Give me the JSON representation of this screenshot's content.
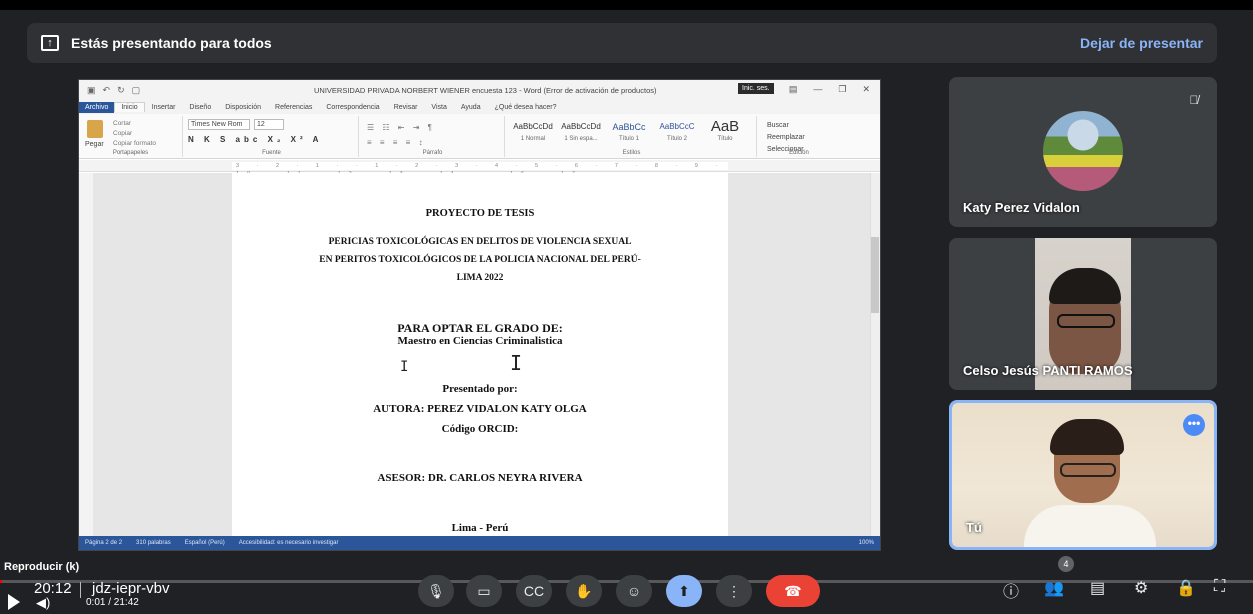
{
  "banner": {
    "message": "Estás presentando para todos",
    "stop_label": "Dejar de presentar"
  },
  "word": {
    "title": "UNIVERSIDAD PRIVADA NORBERT WIENER encuesta 123  -  Word (Error de activación de productos)",
    "signin": "Inic. ses.",
    "tabs": [
      "Archivo",
      "Inicio",
      "Insertar",
      "Diseño",
      "Disposición",
      "Referencias",
      "Correspondencia",
      "Revisar",
      "Vista",
      "Ayuda",
      "¿Qué desea hacer?"
    ],
    "clipboard": {
      "paste": "Pegar",
      "cut": "Cortar",
      "copy": "Copiar",
      "format": "Copiar formato",
      "label": "Portapapeles"
    },
    "font": {
      "name": "Times New Rom",
      "size": "12",
      "label": "Fuente"
    },
    "paragraph_label": "Párrafo",
    "styles": [
      {
        "sample": "AaBbCcDd",
        "name": "1 Normal"
      },
      {
        "sample": "AaBbCcDd",
        "name": "1 Sin espa..."
      },
      {
        "sample": "AaBbCc",
        "name": "Título 1"
      },
      {
        "sample": "AaBbCcC",
        "name": "Título 2"
      },
      {
        "sample": "AaB",
        "name": "Título"
      }
    ],
    "styles_label": "Estilos",
    "editing": {
      "find": "Buscar",
      "replace": "Reemplazar",
      "select": "Seleccionar",
      "label": "Edición"
    },
    "ruler": "3 · 2 · 1 · · 1 · 2 · 3 · 4 · 5 · 6 · 7 · 8 · 9 · 10 · 11 · 12 · 13 · 14 · · 16 · 17",
    "status": {
      "page": "Página 2 de 2",
      "words": "310 palabras",
      "lang": "Español (Perú)",
      "access": "Accesibilidad: es necesario investigar",
      "zoom": "100%"
    }
  },
  "document": {
    "heading": "PROYECTO DE TESIS",
    "line1": "PERICIAS TOXICOLÓGICAS EN DELITOS DE VIOLENCIA SEXUAL",
    "line2": "EN PERITOS TOXICOLÓGICOS DE LA POLICIA NACIONAL DEL PERÚ-",
    "line3": "LIMA 2022",
    "degree1": "PARA OPTAR EL GRADO DE:",
    "degree2": "Maestro en Ciencias Criminalistica",
    "presented": "Presentado por:",
    "author": "AUTORA: PEREZ VIDALON KATY OLGA",
    "orcid": "Código ORCID:",
    "advisor": "ASESOR: DR. CARLOS NEYRA RIVERA",
    "city": "Lima - Perú"
  },
  "participants": [
    {
      "name": "Katy Perez Vidalon",
      "muted": true
    },
    {
      "name": "Celso Jesús PANTI RAMOS"
    },
    {
      "name": "Tú"
    }
  ],
  "player": {
    "hint": "Reproducir (k)",
    "clock": "20:12",
    "meeting_code": "jdz-iepr-vbv",
    "video_time": "0:01 / 21:42",
    "participants_count": "4",
    "progress": 0.001
  },
  "colors": {
    "accent": "#8ab4f8",
    "end_call": "#ea4335",
    "word_blue": "#2b579a"
  }
}
